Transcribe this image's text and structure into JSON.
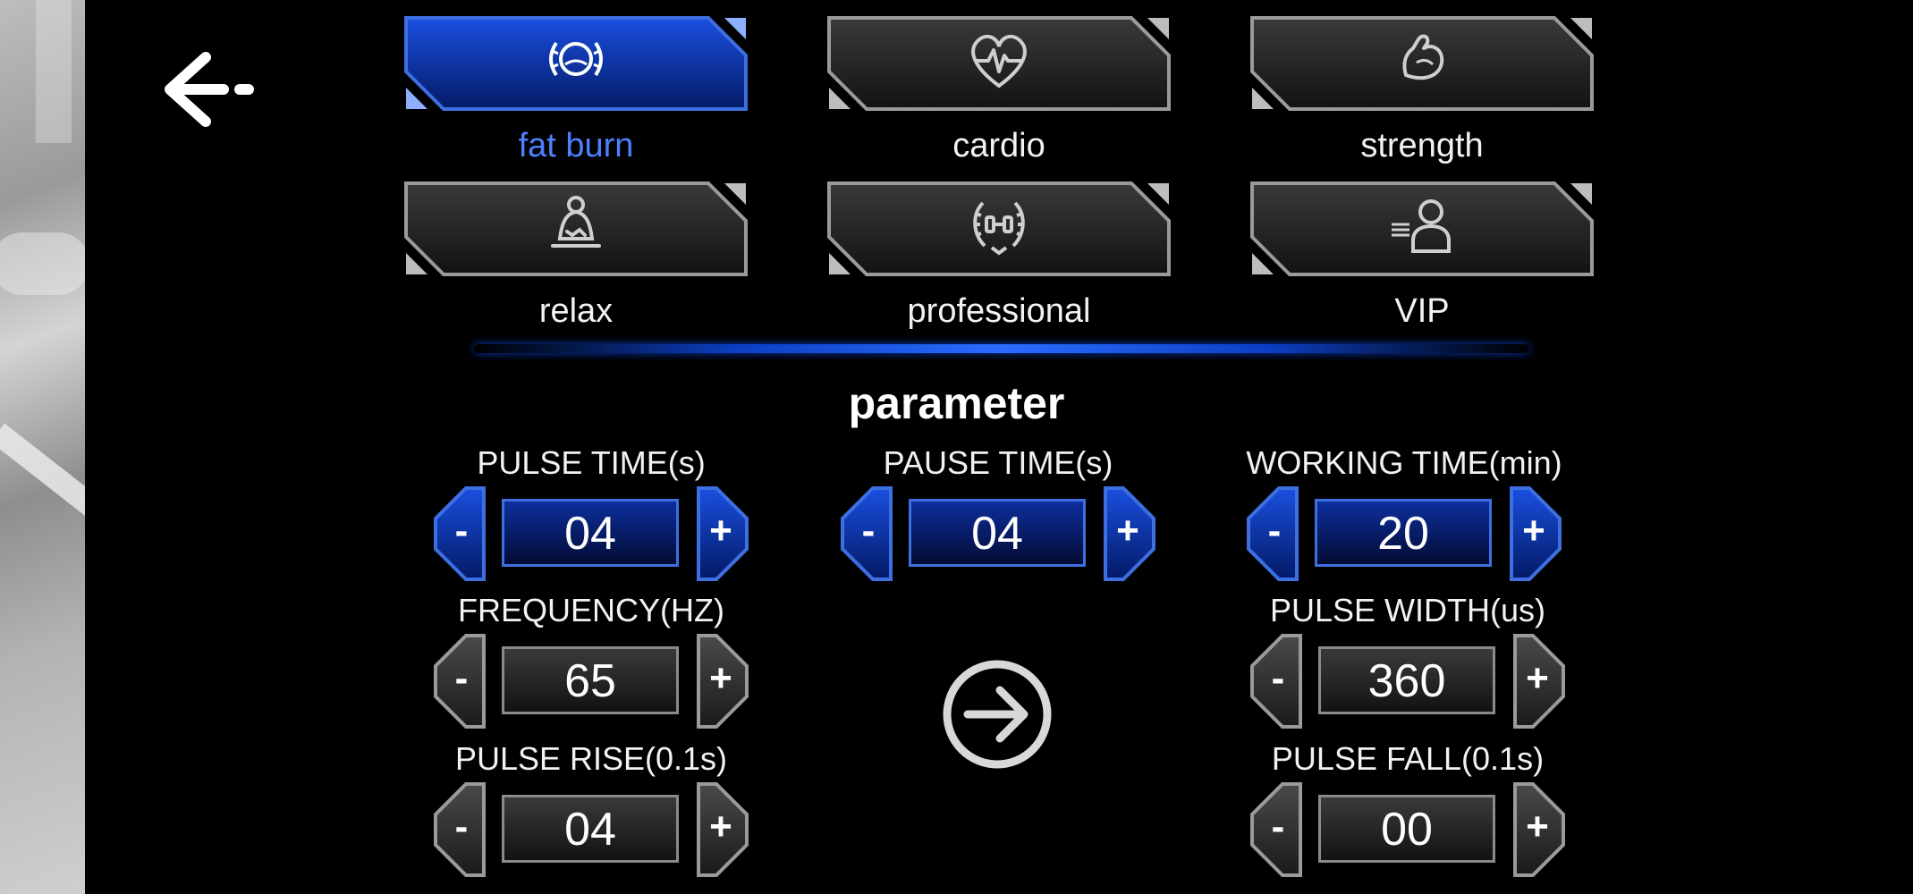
{
  "modes": [
    {
      "label": "fat burn",
      "icon": "fat-burn-icon",
      "active": true
    },
    {
      "label": "cardio",
      "icon": "heart-pulse-icon",
      "active": false
    },
    {
      "label": "strength",
      "icon": "flexed-arm-icon",
      "active": false
    },
    {
      "label": "relax",
      "icon": "meditation-icon",
      "active": false
    },
    {
      "label": "professional",
      "icon": "laurel-dumbbell-icon",
      "active": false
    },
    {
      "label": "VIP",
      "icon": "vip-person-icon",
      "active": false
    }
  ],
  "parameter_title": "parameter",
  "controls": {
    "pulse_time": {
      "label": "PULSE TIME(s)",
      "value": "04"
    },
    "pause_time": {
      "label": "PAUSE TIME(s)",
      "value": "04"
    },
    "working_time": {
      "label": "WORKING TIME(min)",
      "value": "20"
    },
    "frequency": {
      "label": "FREQUENCY(HZ)",
      "value": "65"
    },
    "pulse_width": {
      "label": "PULSE WIDTH(us)",
      "value": "360"
    },
    "pulse_rise": {
      "label": "PULSE RISE(0.1s)",
      "value": "04"
    },
    "pulse_fall": {
      "label": "PULSE FALL(0.1s)",
      "value": "00"
    }
  },
  "stepper_minus": "-",
  "stepper_plus": "+",
  "colors": {
    "accent": "#1a4fe0",
    "active_label": "#4d7fff",
    "background": "#000000"
  }
}
